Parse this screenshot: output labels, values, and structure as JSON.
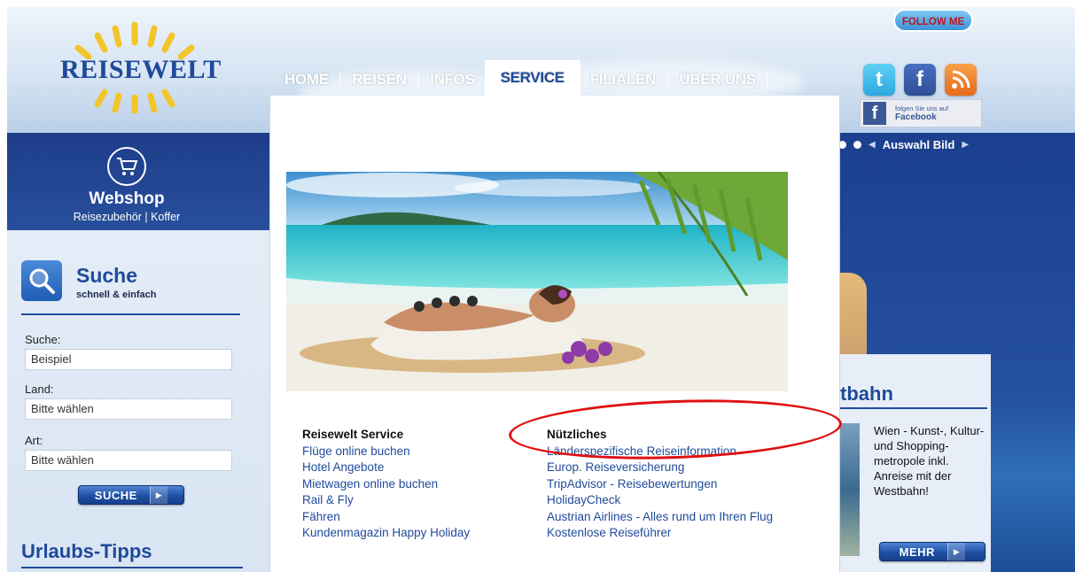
{
  "brand": {
    "logo_text": "REISEWELT"
  },
  "nav": {
    "items": [
      {
        "label": "HOME"
      },
      {
        "label": "REISEN"
      },
      {
        "label": "INFOS"
      },
      {
        "label": "SERVICE"
      },
      {
        "label": "FILIALEN"
      },
      {
        "label": "ÜBER UNS"
      }
    ],
    "active": "SERVICE"
  },
  "social": {
    "follow_label": "FOLLOW ME",
    "facebook_badge_line1": "folgen Sie uns auf",
    "facebook_badge_line2": "Facebook",
    "icons": [
      "twitter-icon",
      "facebook-icon",
      "rss-icon"
    ]
  },
  "slider": {
    "label": "Auswahl Bild"
  },
  "webshop": {
    "title": "Webshop",
    "subtitle": "Reisezubehör | Koffer"
  },
  "search": {
    "title": "Suche",
    "subtitle": "schnell & einfach",
    "field1_label": "Suche:",
    "field1_value": "Beispiel",
    "field2_label": "Land:",
    "field2_value": "Bitte wählen",
    "field3_label": "Art:",
    "field3_value": "Bitte wählen",
    "button": "SUCHE"
  },
  "tipps": {
    "title": "Urlaubs-Tipps"
  },
  "service": {
    "col1": {
      "heading": "Reisewelt Service",
      "links": [
        "Flüge online buchen",
        "Hotel Angebote",
        "Mietwagen online buchen",
        "Rail & Fly",
        "Fähren",
        "Kundenmagazin Happy Holiday"
      ]
    },
    "col2": {
      "heading": "Nützliches",
      "links": [
        "Länderspezifische Reiseinformation",
        "Europ. Reiseversicherung",
        "TripAdvisor - Reisebewertungen",
        "HolidayCheck",
        "Austrian Airlines - Alles rund um Ihren Flug",
        "Kostenlose Reiseführer"
      ]
    }
  },
  "teaser": {
    "title": "tbahn",
    "text": "Wien - Kunst-, Kultur- und Shopping-metropole inkl. Anreise mit der Westbahn!",
    "button": "MEHR"
  },
  "colors": {
    "brand_blue": "#1f4a9a",
    "annotation_red": "#e01010"
  }
}
